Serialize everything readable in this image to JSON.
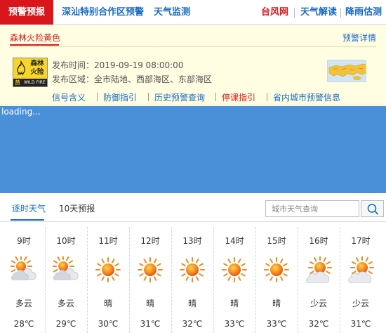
{
  "nav": {
    "items": [
      {
        "label": "预警预报",
        "active": true
      },
      {
        "label": "深汕特别合作区预警"
      },
      {
        "label": "天气监测"
      },
      {
        "label": "台风网",
        "red": true
      },
      {
        "label": "天气解读"
      },
      {
        "label": "降雨估测"
      }
    ]
  },
  "warning": {
    "title": "森林火险黄色",
    "detail_link": "预警详情",
    "badge": {
      "cn": "森林火险",
      "level": "黄",
      "en": "WILD FIRE"
    },
    "issue_time": "发布时间：2019-09-19 08:00:00",
    "issue_area": "发布区域：全市陆地、西部海区、东部海区",
    "links": [
      {
        "label": "信号含义"
      },
      {
        "label": "防御指引"
      },
      {
        "label": "历史预警查询"
      },
      {
        "label": "停课指引",
        "red": true
      },
      {
        "label": "省内城市预警信息"
      }
    ]
  },
  "map": {
    "loading": "loading..."
  },
  "tabs": [
    {
      "label": "逐时天气",
      "active": true
    },
    {
      "label": "10天预报"
    }
  ],
  "search": {
    "placeholder": "城市天气查询"
  },
  "hourly": [
    {
      "time": "9时",
      "desc": "多云",
      "temp": "28℃",
      "icon": "cloudy-icon"
    },
    {
      "time": "10时",
      "desc": "多云",
      "temp": "29℃",
      "icon": "cloudy-icon"
    },
    {
      "time": "11时",
      "desc": "晴",
      "temp": "30℃",
      "icon": "sunny-icon"
    },
    {
      "time": "12时",
      "desc": "晴",
      "temp": "31℃",
      "icon": "sunny-icon"
    },
    {
      "time": "13时",
      "desc": "晴",
      "temp": "32℃",
      "icon": "sunny-icon"
    },
    {
      "time": "14时",
      "desc": "晴",
      "temp": "33℃",
      "icon": "sunny-icon"
    },
    {
      "time": "15时",
      "desc": "晴",
      "temp": "33℃",
      "icon": "sunny-icon"
    },
    {
      "time": "16时",
      "desc": "少云",
      "temp": "32℃",
      "icon": "partly-cloudy-icon"
    },
    {
      "time": "17时",
      "desc": "少云",
      "temp": "31℃",
      "icon": "partly-cloudy-icon"
    }
  ],
  "colors": {
    "brand_red": "#d9161c",
    "link_blue": "#1a6cc2",
    "map_blue": "#4a90d9",
    "warning_bg": "#fffde2",
    "badge_yellow": "#f7d628"
  }
}
